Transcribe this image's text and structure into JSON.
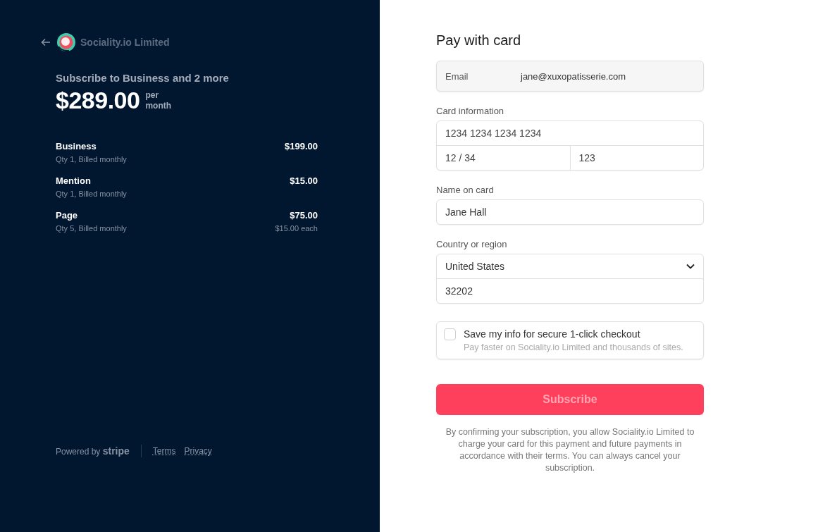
{
  "merchant": {
    "name": "Sociality.io Limited"
  },
  "summary": {
    "title": "Subscribe to Business and 2 more",
    "price": "$289.00",
    "period": [
      "per",
      "month"
    ]
  },
  "line_items": [
    {
      "name": "Business",
      "detail": "Qty 1, Billed monthly",
      "amount": "$199.00"
    },
    {
      "name": "Mention",
      "detail": "Qty 1, Billed monthly",
      "amount": "$15.00"
    },
    {
      "name": "Page",
      "detail": "Qty 5, Billed monthly",
      "amount": "$75.00",
      "unit_price": "$15.00 each"
    }
  ],
  "footer": {
    "powered_by": "Powered by **stripe**",
    "links": [
      "Terms",
      "Privacy"
    ]
  },
  "form": {
    "title": "Pay with card",
    "email": {
      "label": "Email",
      "value": "jane@xuxopatisserie.com"
    },
    "card": {
      "label": "Card information",
      "number_placeholder": "1234 1234 1234 1234",
      "expiry_placeholder": "12 / 34",
      "cvc_placeholder": "123"
    },
    "name": {
      "label": "Name on card",
      "value": "Jane Hall"
    },
    "country": {
      "label": "Country or region",
      "value": "United States",
      "zip": "32202"
    },
    "save_info": {
      "checked": false,
      "label": "Save my info for secure 1-click checkout",
      "hint": "Pay faster on Sociality.io Limited and thousands of sites."
    },
    "submit": "Subscribe",
    "legal": "By confirming your subscription, you allow Sociality.io Limited to charge your card for this payment and future payments in accordance with their terms. You can always cancel your subscription."
  }
}
